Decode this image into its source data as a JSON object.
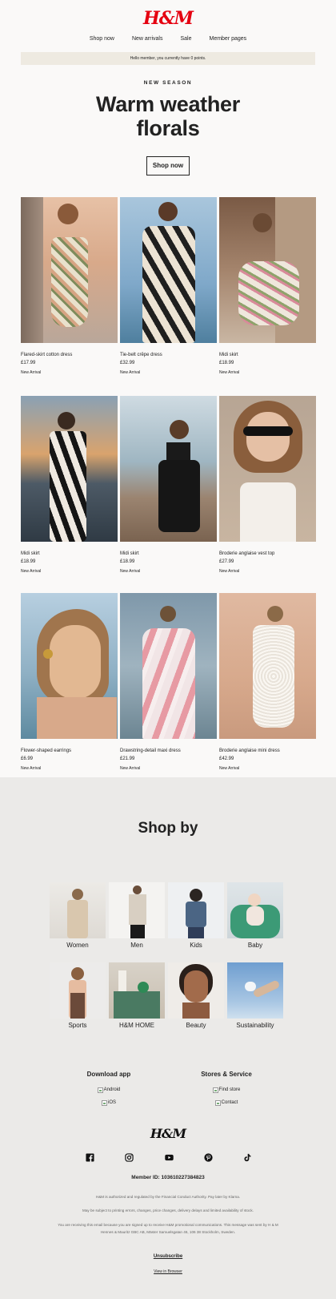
{
  "header": {
    "logo": "H&M",
    "nav": [
      "Shop now",
      "New arrivals",
      "Sale",
      "Member pages"
    ],
    "banner": "Hello member, you currently have 0 points."
  },
  "hero": {
    "eyebrow": "NEW SEASON",
    "headline_line1": "Warm weather",
    "headline_line2": "florals",
    "cta": "Shop now"
  },
  "products": [
    {
      "name": "Flared-skirt cotton dress",
      "price": "£17.99",
      "tag": "New Arrival"
    },
    {
      "name": "Tie-belt crêpe dress",
      "price": "£32.99",
      "tag": "New Arrival"
    },
    {
      "name": "Midi skirt",
      "price": "£18.99",
      "tag": "New Arrival"
    },
    {
      "name": "Midi skirt",
      "price": "£18.99",
      "tag": "New Arrival"
    },
    {
      "name": "Midi skirt",
      "price": "£18.99",
      "tag": "New Arrival"
    },
    {
      "name": "Broderie anglaise vest top",
      "price": "£27.99",
      "tag": "New Arrival"
    },
    {
      "name": "Flower-shaped earrings",
      "price": "£6.99",
      "tag": "New Arrival"
    },
    {
      "name": "Drawstring-detail maxi dress",
      "price": "£21.99",
      "tag": "New Arrival"
    },
    {
      "name": "Broderie anglaise mini dress",
      "price": "£42.99",
      "tag": "New Arrival"
    }
  ],
  "shop_by": {
    "title": "Shop by",
    "categories": [
      "Women",
      "Men",
      "Kids",
      "Baby",
      "Sports",
      "H&M HOME",
      "Beauty",
      "Sustainability"
    ]
  },
  "footer": {
    "download_title": "Download app",
    "download_links": [
      "Android",
      "iOS"
    ],
    "stores_title": "Stores & Service",
    "stores_links": [
      "Find store",
      "Contact"
    ],
    "logo": "H&M",
    "social_icons": [
      "facebook-icon",
      "instagram-icon",
      "youtube-icon",
      "pinterest-icon",
      "tiktok-icon"
    ],
    "member_id": "Member ID:  103610227384823",
    "legal1": "H&M is authorized and regulated by the Financial Conduct Authority. Pay later by Klarna.",
    "legal2": "May be subject to printing errors, changes, price changes, delivery delays and limited availability of stock.",
    "legal3": "You are receiving this email because you are signed up to receive H&M promotional communications. This message was sent by H & M Hennes & Mauritz GBC AB, Mäster Samuelsgatan 46, 106 38 Stockholm, Sweden.",
    "unsubscribe": "Unsubscribe",
    "view_browser": "View in Browser"
  },
  "colors": {
    "brand_red": "#e50010",
    "banner_bg": "#eeeae1",
    "page_bg": "#faf9f8",
    "shopby_bg": "#ebeae8"
  }
}
